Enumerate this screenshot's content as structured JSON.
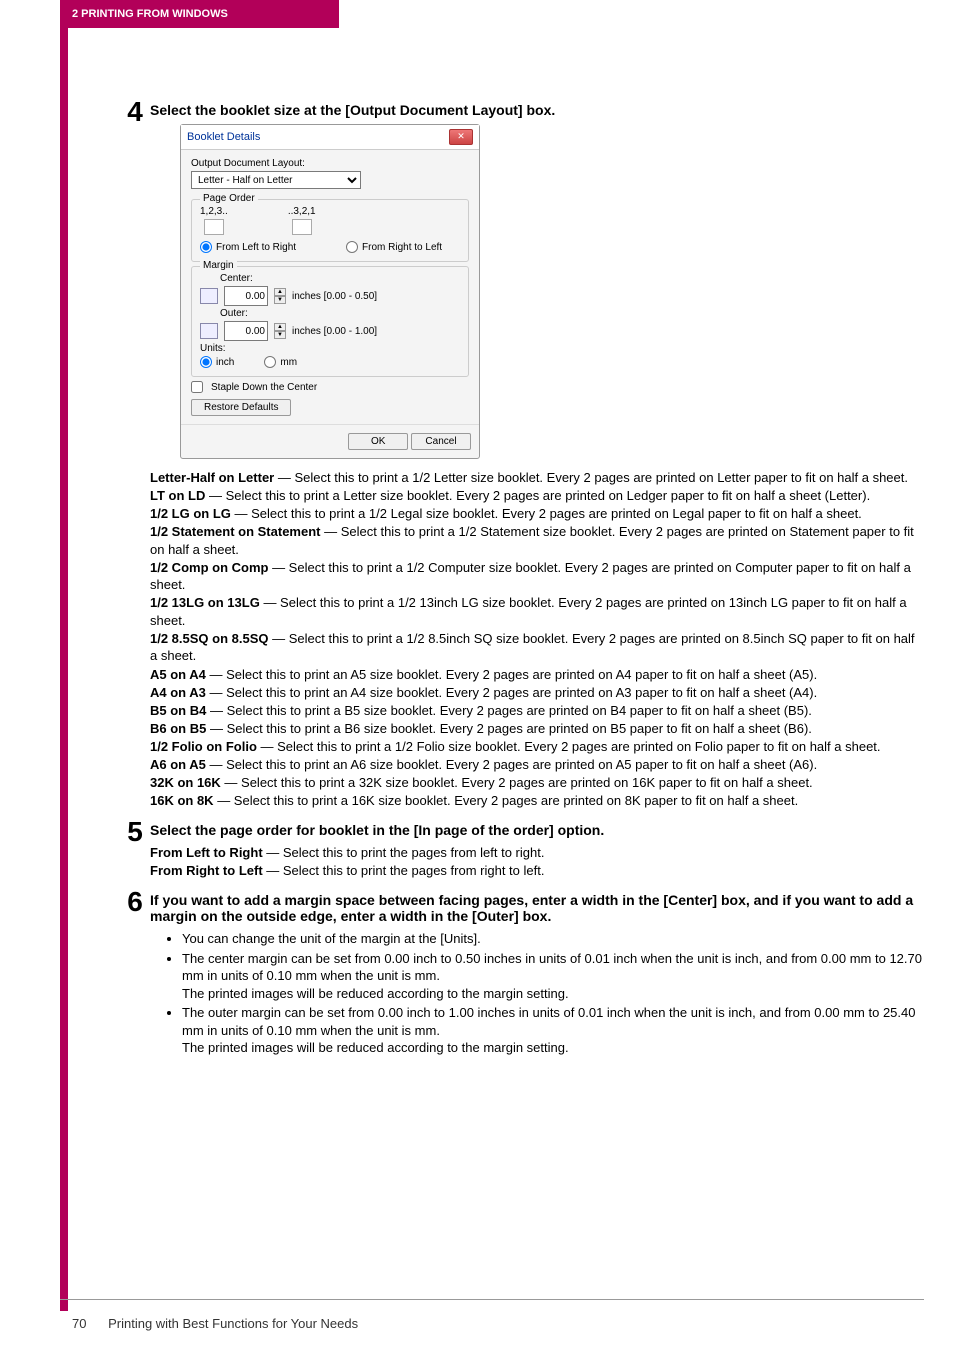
{
  "header": {
    "chapter": "2 PRINTING FROM WINDOWS"
  },
  "footer": {
    "page": "70",
    "section": "Printing with Best Functions for Your Needs"
  },
  "step4": {
    "num": "4",
    "heading": "Select the booklet size at the [Output Document Layout] box.",
    "options": [
      {
        "name": "Letter-Half on Letter",
        "desc": " — Select this to print a 1/2 Letter size booklet.  Every 2 pages are printed on Letter paper to fit on half a sheet."
      },
      {
        "name": "LT on LD",
        "desc": " — Select this to print a Letter size booklet.  Every 2 pages are printed on Ledger paper to fit on half a sheet (Letter)."
      },
      {
        "name": "1/2 LG on LG",
        "desc": " — Select this to print a 1/2 Legal size booklet.  Every 2 pages are printed on Legal paper to fit on half a sheet."
      },
      {
        "name": "1/2 Statement on Statement",
        "desc": " — Select this to print a 1/2 Statement size booklet.  Every 2 pages are printed on Statement paper to fit on half a sheet."
      },
      {
        "name": "1/2 Comp on Comp",
        "desc": " — Select this to print a 1/2 Computer size booklet.  Every 2 pages are printed on Computer paper to fit on half a sheet."
      },
      {
        "name": "1/2 13LG on 13LG",
        "desc": " — Select this to print a 1/2 13inch LG size booklet.  Every 2 pages are printed on 13inch LG paper to fit on half a sheet."
      },
      {
        "name": "1/2 8.5SQ on 8.5SQ",
        "desc": " — Select this to print a 1/2 8.5inch SQ size booklet.  Every 2 pages are printed on 8.5inch SQ paper to fit on half a sheet."
      },
      {
        "name": "A5 on A4",
        "desc": " — Select this to print an A5 size booklet.  Every 2 pages are printed on A4 paper to fit on half a sheet (A5)."
      },
      {
        "name": "A4 on A3",
        "desc": " — Select this to print an A4 size booklet.  Every 2 pages are printed on A3 paper to fit on half a sheet (A4)."
      },
      {
        "name": "B5 on B4",
        "desc": " — Select this to print a B5 size booklet.  Every 2 pages are printed on B4 paper to fit on half a sheet (B5)."
      },
      {
        "name": "B6 on B5",
        "desc": " — Select this to print a B6 size booklet.  Every 2 pages are printed on B5 paper to fit on half a sheet (B6)."
      },
      {
        "name": "1/2 Folio on Folio",
        "desc": " — Select this to print a 1/2 Folio size booklet.  Every 2 pages are printed on Folio paper to fit on half a sheet."
      },
      {
        "name": "A6 on A5",
        "desc": " — Select this to print an A6 size booklet.  Every 2 pages are printed on A5 paper to fit on half a sheet (A6)."
      },
      {
        "name": "32K on 16K",
        "desc": " — Select this to print a 32K size booklet.  Every 2 pages are printed on 16K paper to fit on half a sheet."
      },
      {
        "name": "16K on 8K",
        "desc": " — Select this to print a 16K size booklet.  Every 2 pages are printed on 8K paper to fit on half a sheet."
      }
    ]
  },
  "step5": {
    "num": "5",
    "heading": "Select the page order for booklet in the [In page of the order] option.",
    "lines": [
      {
        "name": "From Left to Right",
        "desc": " — Select this to print the pages from left to right."
      },
      {
        "name": "From Right to Left",
        "desc": " — Select this to print the pages from right to left."
      }
    ]
  },
  "step6": {
    "num": "6",
    "heading": "If you want to add a margin space between facing pages, enter a width in the [Center] box, and if you want to add a margin on the outside edge, enter a width in the [Outer] box.",
    "bullets": [
      "You can change the unit of the margin at the [Units].",
      "The center margin can be set from 0.00 inch to 0.50 inches in units of 0.01 inch when the unit is inch, and from 0.00 mm to 12.70 mm in units of 0.10 mm when the unit is mm.\nThe printed images will be reduced according to the margin setting.",
      "The outer margin can be set from 0.00 inch to 1.00 inches in units of 0.01 inch when the unit is inch, and from 0.00 mm to 25.40 mm in units of 0.10 mm when the unit is mm.\nThe printed images will be reduced according to the margin setting."
    ]
  },
  "dialog": {
    "title": "Booklet Details",
    "odl_label": "Output Document Layout:",
    "odl_value": "Letter - Half on Letter",
    "page_order_label": "Page Order",
    "po_left_seq": "1,2,3..",
    "po_right_seq": "..3,2,1",
    "po_left": "From Left to Right",
    "po_right": "From Right to Left",
    "margin_label": "Margin",
    "center_label": "Center:",
    "center_value": "0.00",
    "center_range": "inches [0.00 - 0.50]",
    "outer_label": "Outer:",
    "outer_value": "0.00",
    "outer_range": "inches [0.00 - 1.00]",
    "units_label": "Units:",
    "unit_inch": "inch",
    "unit_mm": "mm",
    "staple_label": "Staple Down the Center",
    "restore": "Restore Defaults",
    "ok": "OK",
    "cancel": "Cancel"
  }
}
